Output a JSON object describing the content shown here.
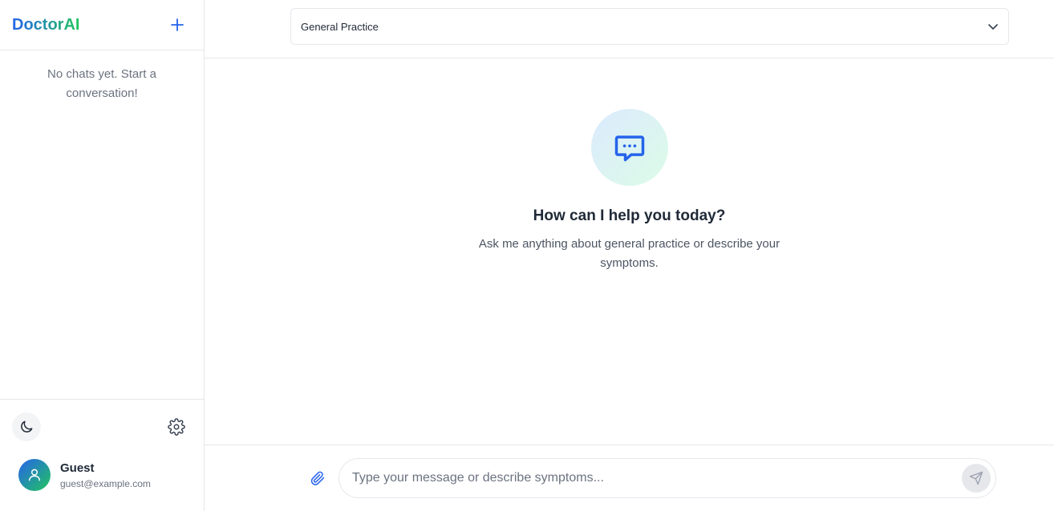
{
  "brand": {
    "name": "DoctorAI"
  },
  "sidebar": {
    "new_chat_icon": "plus-icon",
    "empty_message": "No chats yet. Start a conversation!",
    "theme_icon": "moon-icon",
    "settings_icon": "gear-icon"
  },
  "user": {
    "name": "Guest",
    "email": "guest@example.com",
    "avatar_icon": "user-icon"
  },
  "topbar": {
    "specialty": "General Practice",
    "dropdown_icon": "chevron-down-icon"
  },
  "welcome": {
    "icon": "chat-bubble-icon",
    "title": "How can I help you today?",
    "subtitle": "Ask me anything about general practice or describe your symptoms."
  },
  "composer": {
    "placeholder": "Type your message or describe symptoms...",
    "value": "",
    "attach_icon": "paperclip-icon",
    "send_icon": "send-icon"
  },
  "colors": {
    "accent_blue": "#2563eb",
    "accent_green": "#22c55e",
    "border": "#e5e7eb",
    "muted_text": "#6b7280"
  }
}
